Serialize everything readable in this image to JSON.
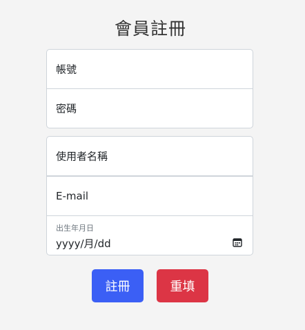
{
  "form": {
    "title": "會員註冊",
    "account_placeholder": "帳號",
    "password_placeholder": "密碼",
    "username_placeholder": "使用者名稱",
    "email_placeholder": "E-mail",
    "birth_label": "出生年月日",
    "birth_value": "yyyy/月/dd",
    "calendar_icon": "calendar-icon",
    "submit_label": "註冊",
    "reset_label": "重填"
  },
  "colors": {
    "background": "#f4f4f4",
    "submit": "#3b5ff5",
    "reset": "#dc3545"
  }
}
